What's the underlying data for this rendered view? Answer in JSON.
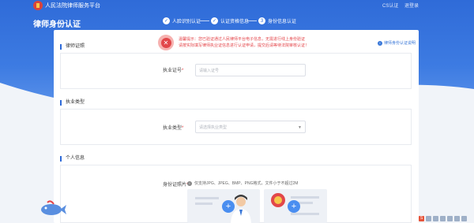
{
  "header": {
    "site_name": "人民法院律师服务平台",
    "user_link": "CS认证",
    "logout_link": "退登录",
    "page_title": "律师身份认证"
  },
  "steps": [
    {
      "label": "人脸识别认证",
      "icon": "check-icon"
    },
    {
      "label": "认证资格信息",
      "icon": "check-icon"
    },
    {
      "label": "身份信息认证",
      "number": "3"
    }
  ],
  "notice": {
    "line1": "温馨提示：您已验证通过人民律师平台电子信息，无需进行线上身份验证",
    "line2": "请按实际填写律师执业证信息进行认证申请，提交后请等待法院审核认证！"
  },
  "guide_link": "律师身份认证说明",
  "sections": {
    "s1": {
      "title": "律师证照",
      "field_label": "执业证号",
      "placeholder": "请输入证号"
    },
    "s2": {
      "title": "执业类型",
      "field_label": "执业类型",
      "placeholder": "请选择执业类型"
    },
    "s3": {
      "title": "个人信息",
      "field_label": "身份证照片",
      "upload_tip": "仅支持JPG、JPEG、BMP、PNG格式，文件小于不超过2M"
    }
  },
  "colors": {
    "brand": "#2f6bd8",
    "alert": "#e4454a",
    "upload_button": "#4a8ef0"
  }
}
